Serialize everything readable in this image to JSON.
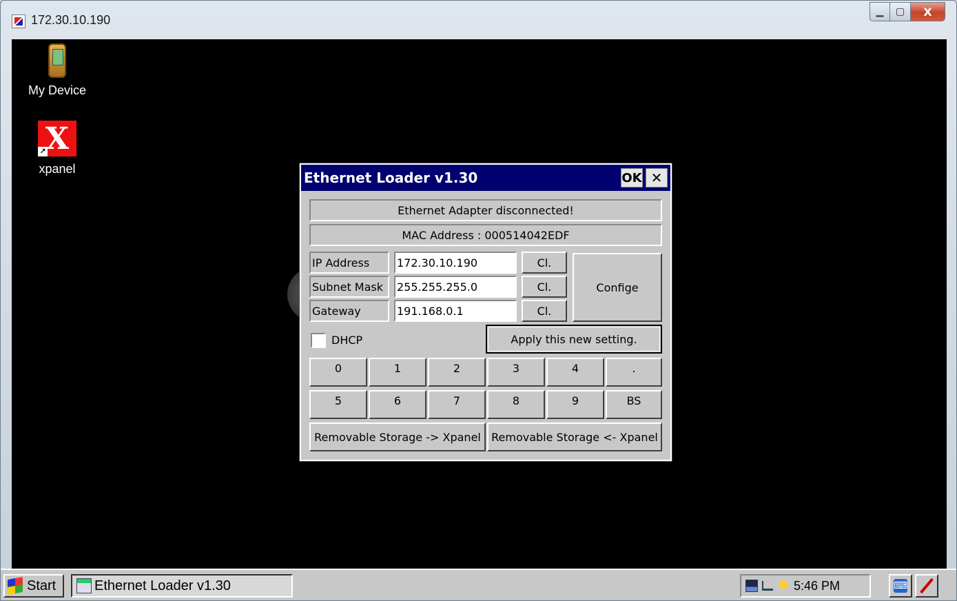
{
  "host": {
    "title": "172.30.10.190",
    "buttons": {
      "minimize": "▁",
      "maximize": "▢",
      "close": "X"
    }
  },
  "desktop": {
    "icons": [
      {
        "label": "My Device",
        "icon": "device-icon"
      },
      {
        "label": "xpanel",
        "icon": "xpanel-shortcut-icon"
      }
    ]
  },
  "dialog": {
    "title": "Ethernet Loader v1.30",
    "ok_label": "OK",
    "close_label": "✕",
    "status_text": "Ethernet Adapter disconnected!",
    "mac_text": "MAC Address : 000514042EDF",
    "fields": [
      {
        "label": "IP Address",
        "value": "172.30.10.190",
        "clear_label": "Cl."
      },
      {
        "label": "Subnet Mask",
        "value": "255.255.255.0",
        "clear_label": "Cl."
      },
      {
        "label": "Gateway",
        "value": "191.168.0.1",
        "clear_label": "Cl."
      }
    ],
    "config_label": "Confige",
    "dhcp_label": "DHCP",
    "dhcp_checked": false,
    "apply_label": "Apply this new setting.",
    "keypad_row1": [
      "0",
      "1",
      "2",
      "3",
      "4",
      "."
    ],
    "keypad_row2": [
      "5",
      "6",
      "7",
      "8",
      "9",
      "BS"
    ],
    "storage_to_label": "Removable Storage -> Xpanel",
    "storage_from_label": "Removable Storage <- Xpanel"
  },
  "taskbar": {
    "start_label": "Start",
    "task_label": "Ethernet Loader v1.30",
    "clock": "5:46 PM",
    "tray_icons": [
      "network-icon",
      "usb-icon",
      "power-icon"
    ]
  }
}
